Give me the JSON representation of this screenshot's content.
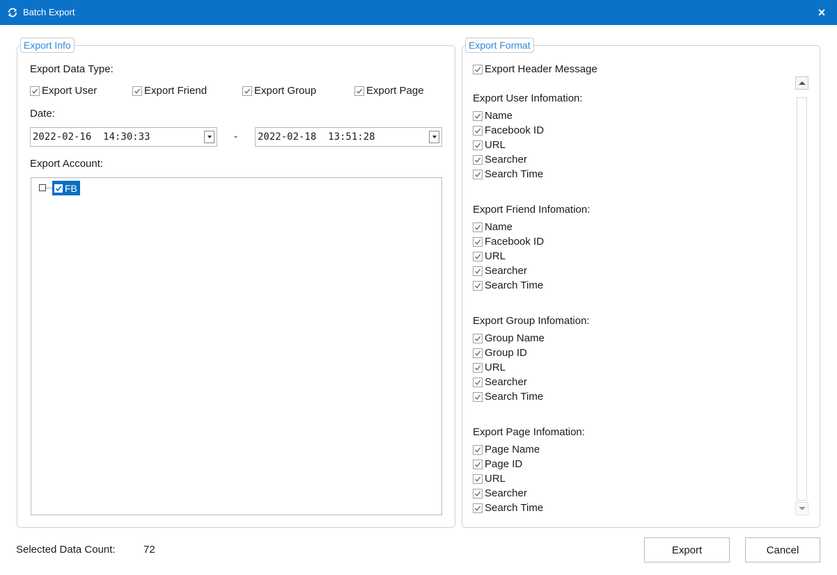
{
  "window": {
    "title": "Batch Export",
    "close_label": "×"
  },
  "export_info": {
    "legend": "Export Info",
    "data_type_label": "Export Data Type:",
    "data_types": [
      {
        "label": "Export User",
        "checked": true
      },
      {
        "label": "Export Friend",
        "checked": true
      },
      {
        "label": "Export Group",
        "checked": true
      },
      {
        "label": "Export Page",
        "checked": true
      }
    ],
    "date_label": "Date:",
    "date_from": "2022-02-16  14:30:33",
    "date_sep": "-",
    "date_to": "2022-02-18  13:51:28",
    "account_label": "Export Account:",
    "tree": [
      {
        "label": "FB",
        "checked": true,
        "selected": true
      }
    ]
  },
  "export_format": {
    "legend": "Export Format",
    "header_message": {
      "label": "Export Header Message",
      "checked": true
    },
    "sections": [
      {
        "title": "Export User Infomation:",
        "fields": [
          "Name",
          "Facebook ID",
          "URL",
          "Searcher",
          "Search Time"
        ]
      },
      {
        "title": "Export Friend Infomation:",
        "fields": [
          "Name",
          "Facebook ID",
          "URL",
          "Searcher",
          "Search Time"
        ]
      },
      {
        "title": "Export Group Infomation:",
        "fields": [
          "Group Name",
          "Group ID",
          "URL",
          "Searcher",
          "Search Time"
        ]
      },
      {
        "title": "Export Page Infomation:",
        "fields": [
          "Page Name",
          "Page ID",
          "URL",
          "Searcher",
          "Search Time"
        ]
      }
    ]
  },
  "footer": {
    "count_label": "Selected Data Count:",
    "count_value": "72",
    "export_button": "Export",
    "cancel_button": "Cancel"
  },
  "colors": {
    "titlebar": "#0a73c8",
    "legend_text": "#2c8ad9",
    "selection": "#0a6fc4"
  }
}
